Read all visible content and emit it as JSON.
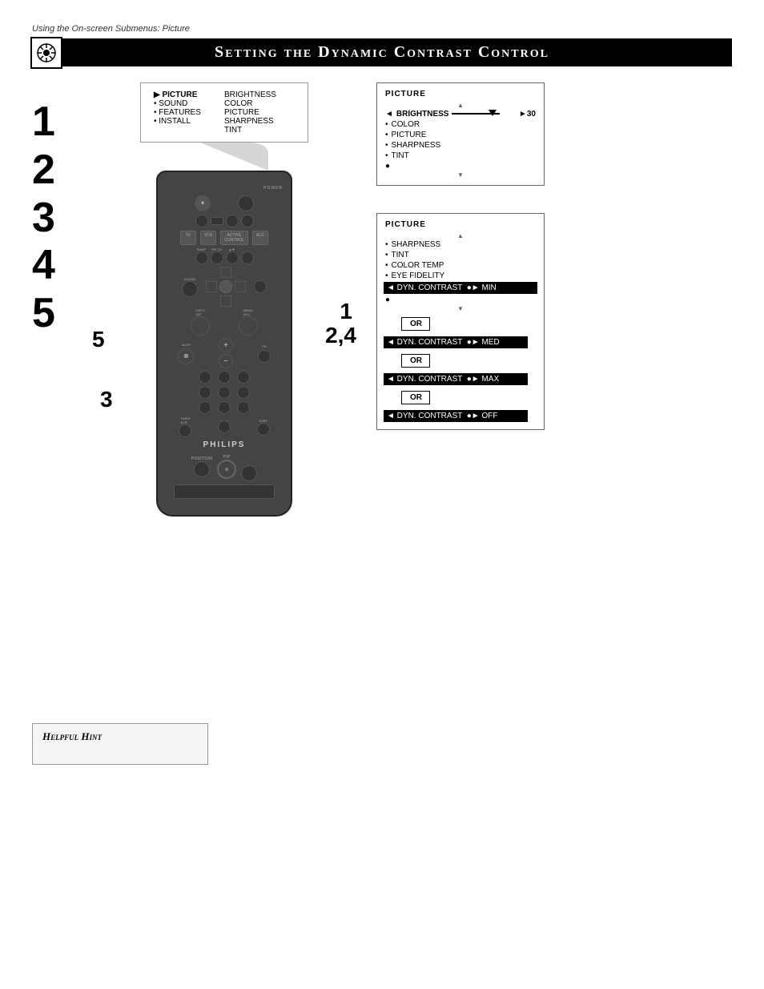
{
  "page": {
    "subtitle": "Using the On-screen Submenus: Picture",
    "title": "Setting the Dynamic Contrast Control"
  },
  "steps": {
    "numbers": [
      "1",
      "2",
      "3",
      "4",
      "5"
    ]
  },
  "onscreen_menu": {
    "items_left": [
      "▶ PICTURE",
      "• SOUND",
      "• FEATURES",
      "• INSTALL"
    ],
    "items_right": [
      "BRIGHTNESS",
      "COLOR",
      "PICTURE",
      "SHARPNESS",
      "TINT"
    ]
  },
  "picture_menu_1": {
    "title": "PICTURE",
    "scroll_up": "▲",
    "items": [
      {
        "bullet": "◄",
        "label": "BRIGHTNESS",
        "value": "►30"
      },
      {
        "bullet": "•",
        "label": "COLOR"
      },
      {
        "bullet": "•",
        "label": "PICTURE"
      },
      {
        "bullet": "•",
        "label": "SHARPNESS"
      },
      {
        "bullet": "•",
        "label": "TINT"
      },
      {
        "bullet": "●",
        "label": ""
      }
    ],
    "scroll_down": "▼"
  },
  "picture_menu_2": {
    "title": "PICTURE",
    "scroll_up": "▲",
    "items": [
      {
        "bullet": "•",
        "label": "SHARPNESS"
      },
      {
        "bullet": "•",
        "label": "TINT"
      },
      {
        "bullet": "•",
        "label": "COLOR TEMP"
      },
      {
        "bullet": "•",
        "label": "EYE FIDELITY"
      }
    ],
    "dyn_contrast_row": "◄ DYN. CONTRAST  ●► MIN",
    "scroll_down": "▼",
    "or_rows": [
      {
        "label": "◄ DYN. CONTRAST  ●► MED"
      },
      {
        "label": "◄ DYN. CONTRAST  ●► MAX"
      },
      {
        "label": "◄ DYN. CONTRAST  ●► OFF"
      }
    ]
  },
  "hint_box": {
    "title": "Helpful Hint"
  },
  "remote": {
    "brand": "PHILIPS",
    "power_label": "POWER"
  },
  "step_overlays": {
    "step1": "1",
    "step2_4": "2,4",
    "step3": "3",
    "step5": "5"
  }
}
